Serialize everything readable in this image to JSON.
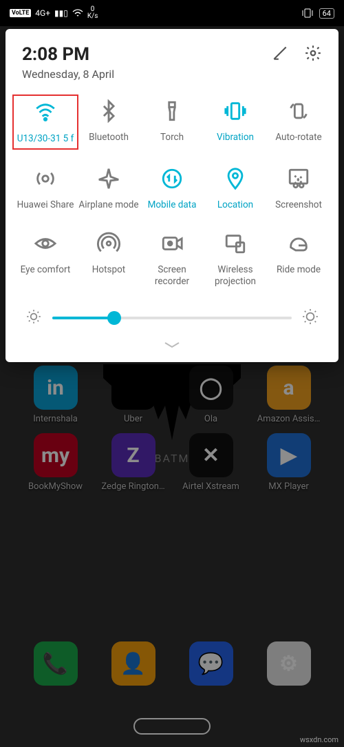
{
  "statusbar": {
    "volte": "VoLTE",
    "net": "4G+",
    "speed_val": "0",
    "speed_unit": "K/s",
    "battery": "64"
  },
  "panel": {
    "time": "2:08 PM",
    "date": "Wednesday, 8 April",
    "brightness_percent": 26
  },
  "tiles": [
    {
      "id": "wifi",
      "label": "U13/30-31 5 f",
      "active": true,
      "icon": "wifi-icon"
    },
    {
      "id": "bluetooth",
      "label": "Bluetooth",
      "active": false,
      "icon": "bluetooth-icon"
    },
    {
      "id": "torch",
      "label": "Torch",
      "active": false,
      "icon": "torch-icon"
    },
    {
      "id": "vibration",
      "label": "Vibration",
      "active": true,
      "icon": "vibration-icon"
    },
    {
      "id": "autorotate",
      "label": "Auto-rotate",
      "active": false,
      "icon": "rotate-icon"
    },
    {
      "id": "huaweishare",
      "label": "Huawei Share",
      "active": false,
      "icon": "share-icon"
    },
    {
      "id": "airplane",
      "label": "Airplane mode",
      "active": false,
      "icon": "airplane-icon"
    },
    {
      "id": "mobiledata",
      "label": "Mobile data",
      "active": true,
      "icon": "data-icon"
    },
    {
      "id": "location",
      "label": "Location",
      "active": true,
      "icon": "location-icon"
    },
    {
      "id": "screenshot",
      "label": "Screenshot",
      "active": false,
      "icon": "screenshot-icon"
    },
    {
      "id": "eyecomfort",
      "label": "Eye comfort",
      "active": false,
      "icon": "eye-icon"
    },
    {
      "id": "hotspot",
      "label": "Hotspot",
      "active": false,
      "icon": "hotspot-icon"
    },
    {
      "id": "recorder",
      "label": "Screen recorder",
      "active": false,
      "icon": "recorder-icon"
    },
    {
      "id": "projection",
      "label": "Wireless projection",
      "active": false,
      "icon": "projection-icon"
    },
    {
      "id": "ridemode",
      "label": "Ride mode",
      "active": false,
      "icon": "helmet-icon"
    }
  ],
  "apps_row1": [
    {
      "label": "Internshala",
      "bg": "#0aa0d6",
      "glyph": "in"
    },
    {
      "label": "Uber",
      "bg": "#000000",
      "glyph": ""
    },
    {
      "label": "Ola",
      "bg": "#111111",
      "glyph": "◯"
    },
    {
      "label": "Amazon Assis…",
      "bg": "#f0a020",
      "glyph": "a"
    }
  ],
  "apps_row2": [
    {
      "label": "BookMyShow",
      "bg": "#c00020",
      "glyph": "my"
    },
    {
      "label": "Zedge Rington…",
      "bg": "#5a2dbb",
      "glyph": "Z"
    },
    {
      "label": "Airtel Xstream",
      "bg": "#101010",
      "glyph": "✕"
    },
    {
      "label": "MX Player",
      "bg": "#1f6fd6",
      "glyph": "▶"
    }
  ],
  "dock": [
    {
      "label": "",
      "bg": "#1aa84a",
      "glyph": "📞"
    },
    {
      "label": "",
      "bg": "#f59e0b",
      "glyph": "👤"
    },
    {
      "label": "",
      "bg": "#2563eb",
      "glyph": "💬"
    },
    {
      "label": "",
      "bg": "#e5e5e5",
      "glyph": "⚙"
    }
  ],
  "wallpaper_text": "BATM",
  "watermark": "wsxdn.com"
}
